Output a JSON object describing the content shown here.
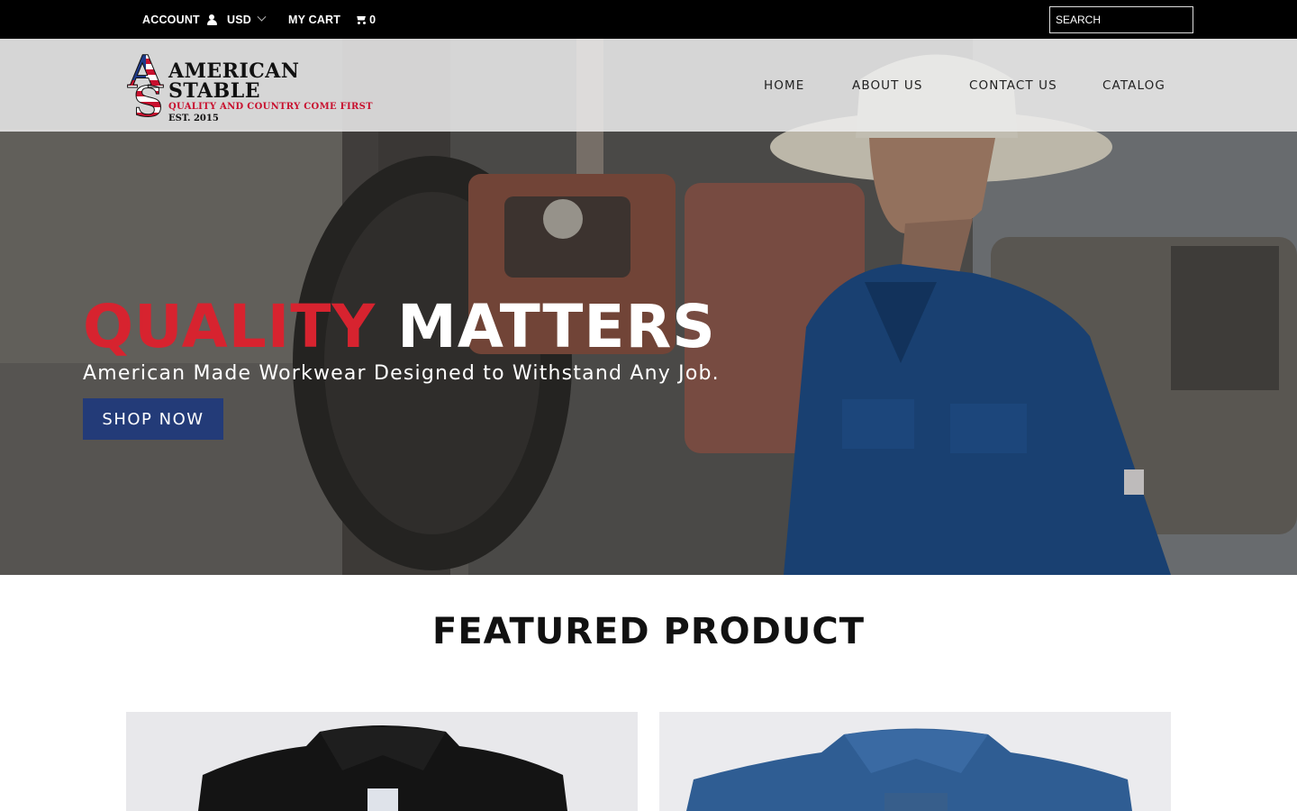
{
  "topbar": {
    "account_label": "ACCOUNT",
    "currency": "USD",
    "cart_label": "MY CART",
    "cart_count": "0",
    "search_placeholder": "SEARCH",
    "icons": [
      "user-icon",
      "chevron-down-icon",
      "cart-icon"
    ]
  },
  "header": {
    "logo": {
      "monogram": "AS",
      "name": "AMERICAN STABLE",
      "tagline": "QUALITY AND COUNTRY COME FIRST",
      "established": "EST. 2015"
    },
    "nav": [
      {
        "label": "HOME"
      },
      {
        "label": "ABOUT US"
      },
      {
        "label": "CONTACT US"
      },
      {
        "label": "CATALOG"
      }
    ]
  },
  "hero": {
    "title_accent": "QUALITY",
    "title_rest": "MATTERS",
    "subtitle": "American Made Workwear Designed to Withstand Any Job.",
    "cta_label": "SHOP NOW"
  },
  "featured": {
    "title": "FEATURED PRODUCT",
    "products": [
      {
        "color_name": "black shirt"
      },
      {
        "color_name": "denim shirt"
      }
    ]
  },
  "colors": {
    "topbar_bg": "#000000",
    "accent_red": "#d7232f",
    "button_blue": "#233b78",
    "header_bg": "#eeeeee"
  }
}
